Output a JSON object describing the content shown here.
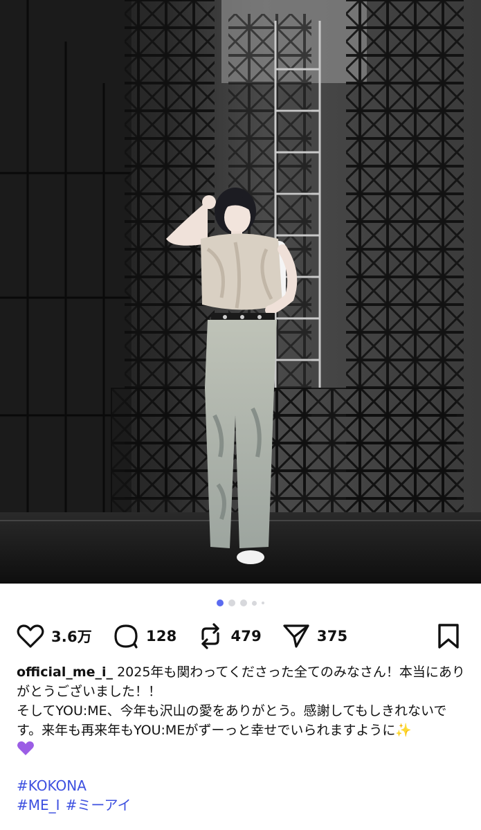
{
  "post": {
    "carousel": {
      "total_images": 5,
      "active_index": 0
    },
    "actions": {
      "likes": "3.6万",
      "comments": "128",
      "reposts": "479",
      "shares": "375"
    },
    "caption": {
      "username": "official_me_i_",
      "line1": "2025年も関わってくださった全てのみなさん！本当にありがとうございました！！",
      "line2": "そしてYOU:ME、今年も沢山の愛をありがとう。感謝してもしきれないです。来年も再来年もYOU:MEがずーっと幸せでいられますように✨",
      "emoji_line_icon": "purple-heart-icon"
    },
    "hashtags": {
      "line1": [
        "#KOKONA"
      ],
      "line2": [
        "#ME_I",
        "#ミーアイ"
      ]
    },
    "colors": {
      "accent": "#5b6bf0",
      "hashtag": "#3d50e0",
      "text": "#111111"
    },
    "icons": [
      "heart-icon",
      "comment-icon",
      "repost-icon",
      "share-icon",
      "bookmark-icon"
    ]
  }
}
